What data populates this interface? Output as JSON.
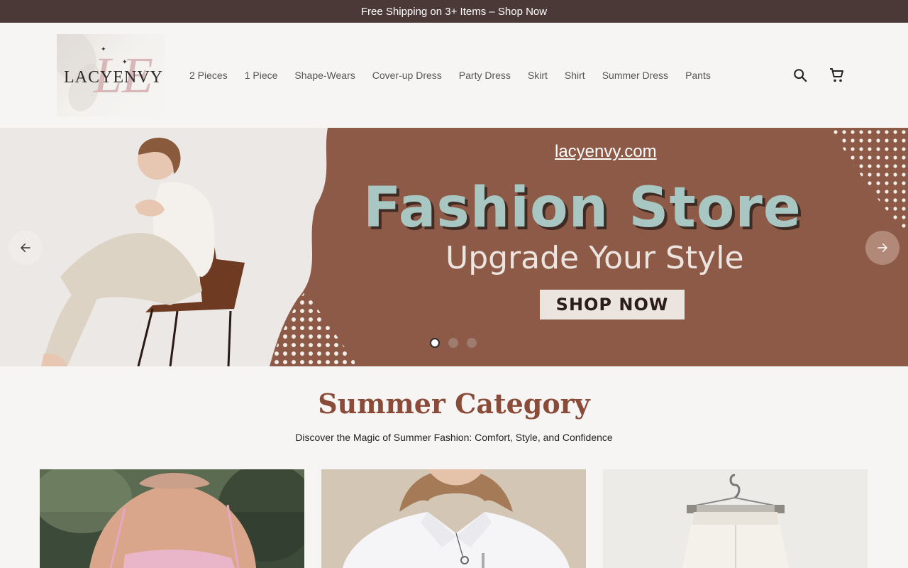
{
  "announcement": {
    "text": "Free Shipping on 3+ Items – Shop Now"
  },
  "brand": {
    "logo_text": "LACYENVY",
    "monogram": "LE"
  },
  "nav": {
    "items": [
      {
        "label": "2 Pieces"
      },
      {
        "label": "1 Piece"
      },
      {
        "label": "Shape-Wears"
      },
      {
        "label": "Cover-up Dress"
      },
      {
        "label": "Party Dress"
      },
      {
        "label": "Skirt"
      },
      {
        "label": "Shirt"
      },
      {
        "label": "Summer Dress"
      },
      {
        "label": "Pants"
      }
    ]
  },
  "header_icons": {
    "search": "search-icon",
    "cart": "cart-icon"
  },
  "hero": {
    "url": "lacyenvy.com",
    "title": "Fashion Store",
    "subtitle": "Upgrade Your Style",
    "cta": "SHOP NOW",
    "slides": 3,
    "active_slide": 1,
    "prev_icon": "arrow-left-icon",
    "next_icon": "arrow-right-icon"
  },
  "section": {
    "title": "Summer Category",
    "subtitle": "Discover the Magic of Summer Fashion: Comfort, Style, and Confidence"
  },
  "colors": {
    "announcement_bg": "#4a3936",
    "hero_bg": "#8c5a46",
    "hero_title": "#a9c7c2",
    "section_title": "#8a4b39"
  }
}
